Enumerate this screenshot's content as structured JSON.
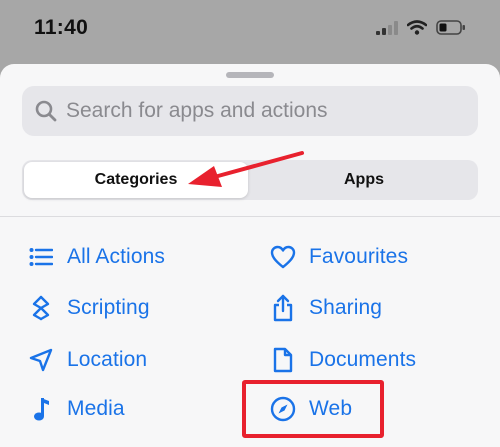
{
  "status": {
    "time": "11:40"
  },
  "search": {
    "placeholder": "Search for apps and actions"
  },
  "tabs": [
    {
      "label": "Categories",
      "selected": true
    },
    {
      "label": "Apps",
      "selected": false
    }
  ],
  "categories": {
    "left": [
      {
        "label": "All Actions",
        "icon": "list-icon"
      },
      {
        "label": "Scripting",
        "icon": "scripting-icon"
      },
      {
        "label": "Location",
        "icon": "location-arrow-icon"
      },
      {
        "label": "Media",
        "icon": "music-note-icon"
      }
    ],
    "right": [
      {
        "label": "Favourites",
        "icon": "heart-icon"
      },
      {
        "label": "Sharing",
        "icon": "share-icon"
      },
      {
        "label": "Documents",
        "icon": "document-icon"
      },
      {
        "label": "Web",
        "icon": "compass-icon"
      }
    ]
  },
  "colors": {
    "accent": "#1a73e8",
    "annotation": "#e8212e"
  }
}
